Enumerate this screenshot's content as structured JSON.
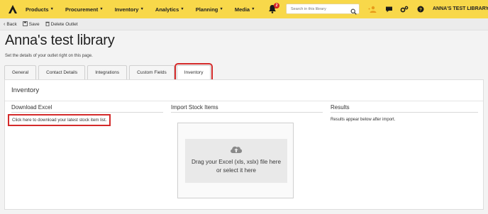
{
  "topbar": {
    "menus": [
      {
        "label": "Products"
      },
      {
        "label": "Procurement"
      },
      {
        "label": "Inventory"
      },
      {
        "label": "Analytics"
      },
      {
        "label": "Planning"
      },
      {
        "label": "Media"
      }
    ],
    "notification_count": "2",
    "search_placeholder": "Search in this library",
    "user_label": "ANNA'S TEST LIBRARY",
    "accent_color": "#f8d84a"
  },
  "toolbar": {
    "back_label": "Back",
    "save_label": "Save",
    "delete_label": "Delete Outlet"
  },
  "page": {
    "title": "Anna's test library",
    "subtitle": "Set the details of your outlet right on this page."
  },
  "tabs": [
    {
      "label": "General"
    },
    {
      "label": "Contact Details"
    },
    {
      "label": "Integrations"
    },
    {
      "label": "Custom Fields"
    },
    {
      "label": "Inventory",
      "active": true
    }
  ],
  "panel": {
    "title": "Inventory",
    "download": {
      "title": "Download Excel",
      "link_text": "Click here to download your latest stock item list."
    },
    "import": {
      "title": "Import Stock Items",
      "drop_line1": "Drag your Excel (xls, xslx) file here",
      "drop_line2": "or select it here"
    },
    "results": {
      "title": "Results",
      "note": "Results appear below after import."
    }
  },
  "highlight_color": "#d42a2a"
}
